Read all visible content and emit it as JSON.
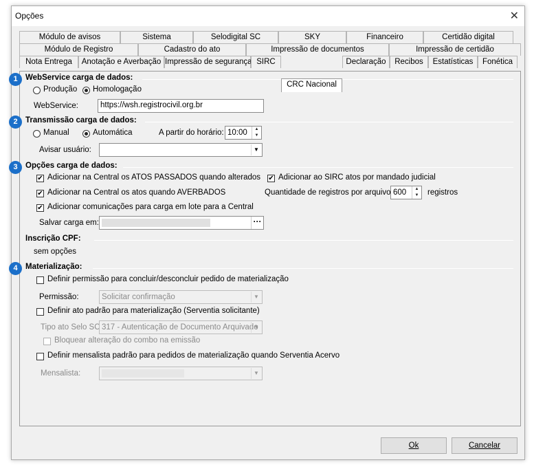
{
  "window": {
    "title": "Opções",
    "close_label": "✕"
  },
  "tabs": {
    "row1": [
      "Módulo de avisos",
      "Sistema",
      "Selodigital SC",
      "SKY",
      "Financeiro",
      "Certidão digital"
    ],
    "row2": [
      "Módulo de Registro",
      "Cadastro do ato",
      "Impressão de documentos",
      "Impressão de certidão"
    ],
    "row3": [
      "Nota Entrega",
      "Anotação e Averbação",
      "Impressão de segurança",
      "SIRC",
      "CRC Nacional",
      "Declaração",
      "Recibos",
      "Estatísticas",
      "Fonética"
    ],
    "active": "CRC Nacional"
  },
  "badges": [
    "1",
    "2",
    "3",
    "4"
  ],
  "webservice": {
    "title": "WebService carga de dados:",
    "radio_producao": "Produção",
    "radio_homologacao": "Homologação",
    "selected": "Homologação",
    "url_label": "WebService:",
    "url_value": "https://wsh.registrocivil.org.br"
  },
  "transmissao": {
    "title": "Transmissão carga de dados:",
    "radio_manual": "Manual",
    "radio_automatica": "Automática",
    "selected": "Automática",
    "horario_label": "A partir do horário:",
    "horario_value": "10:00",
    "avisar_label": "Avisar usuário:",
    "avisar_value": ""
  },
  "opcoes": {
    "title": "Opções carga de dados:",
    "chk_passados": "Adicionar na Central os ATOS PASSADOS quando alterados",
    "chk_averbados": "Adicionar na Central os atos quando AVERBADOS",
    "chk_comunicacoes": "Adicionar comunicações para carga em lote para a Central",
    "chk_sirc": "Adicionar ao SIRC atos por mandado judicial",
    "quantidade_label": "Quantidade de registros por arquivo:",
    "quantidade_value": "600",
    "quantidade_unit": "registros",
    "salvar_label": "Salvar carga em:",
    "dots": "···"
  },
  "inscricao": {
    "title": "Inscrição CPF:",
    "value": "sem opções"
  },
  "materializacao": {
    "title": "Materialização:",
    "chk_permissao": "Definir permissão para concluir/desconcluir pedido de materialização",
    "permissao_label": "Permissão:",
    "permissao_value": "Solicitar confirmação",
    "chk_ato_padrao": "Definir ato padrão para materialização (Serventia solicitante)",
    "tipo_label": "Tipo ato Selo SC:",
    "tipo_value": "317 - Autenticação de Documento Arquivado",
    "chk_bloquear": "Bloquear alteração do combo na emissão",
    "chk_mensalista": "Definir mensalista padrão para pedidos de materialização quando Serventia Acervo",
    "mensalista_label": "Mensalista:"
  },
  "footer": {
    "ok_label": "Ok",
    "cancel_label": "Cancelar"
  }
}
